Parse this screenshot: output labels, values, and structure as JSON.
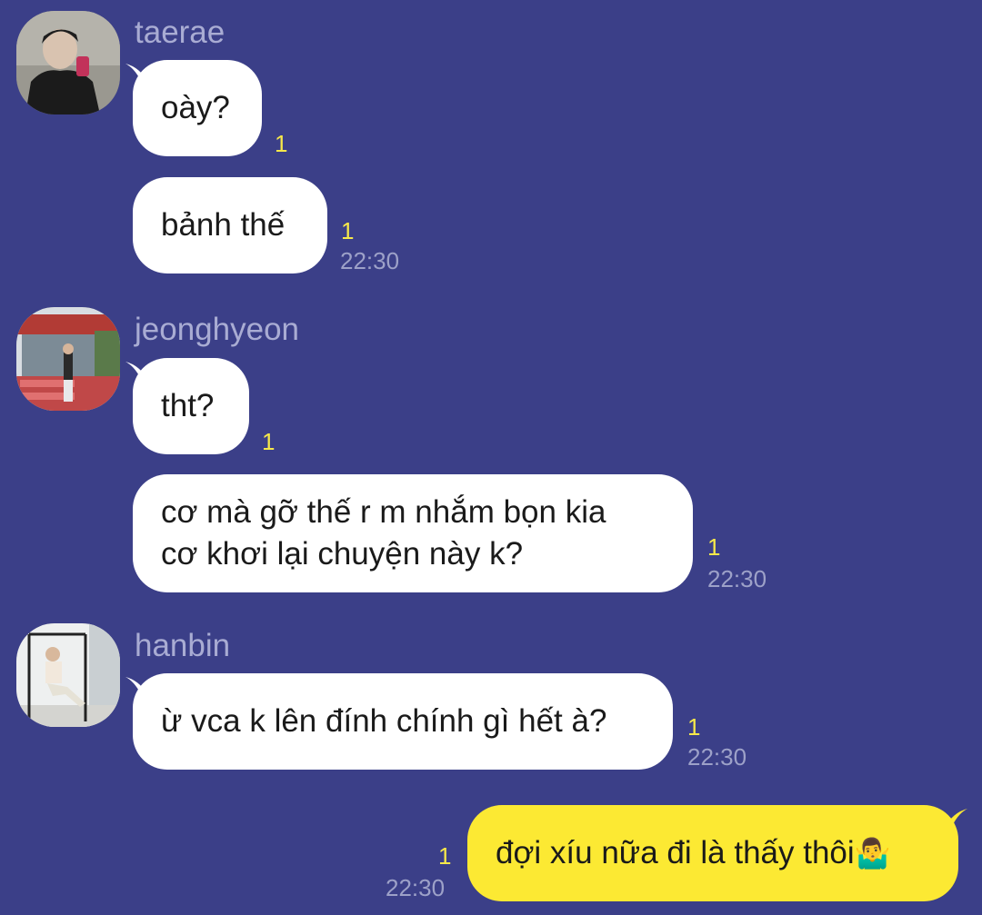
{
  "colors": {
    "background": "#3b3f88",
    "incoming_bubble": "#ffffff",
    "outgoing_bubble": "#fce933",
    "unread_count": "#f6e84a",
    "timestamp": "#9da1c8",
    "sender_name": "#a9acd3"
  },
  "messages": [
    {
      "sender": "taerae",
      "bubbles": [
        {
          "text": "oày?",
          "unread": "1",
          "time": ""
        },
        {
          "text": "bảnh thế",
          "unread": "1",
          "time": "22:30"
        }
      ]
    },
    {
      "sender": "jeonghyeon",
      "bubbles": [
        {
          "text": "tht?",
          "unread": "1",
          "time": ""
        },
        {
          "text": "cơ mà gỡ thế r m nhắm bọn kia\ncơ khơi lại chuyện này k?",
          "unread": "1",
          "time": "22:30"
        }
      ]
    },
    {
      "sender": "hanbin",
      "bubbles": [
        {
          "text": "ừ vca k lên đính chính gì hết à?",
          "unread": "1",
          "time": "22:30"
        }
      ]
    }
  ],
  "outgoing": {
    "text": "đợi xíu nữa đi là thấy thôi",
    "emoji": "🤷‍♂️",
    "unread": "1",
    "time": "22:30"
  }
}
